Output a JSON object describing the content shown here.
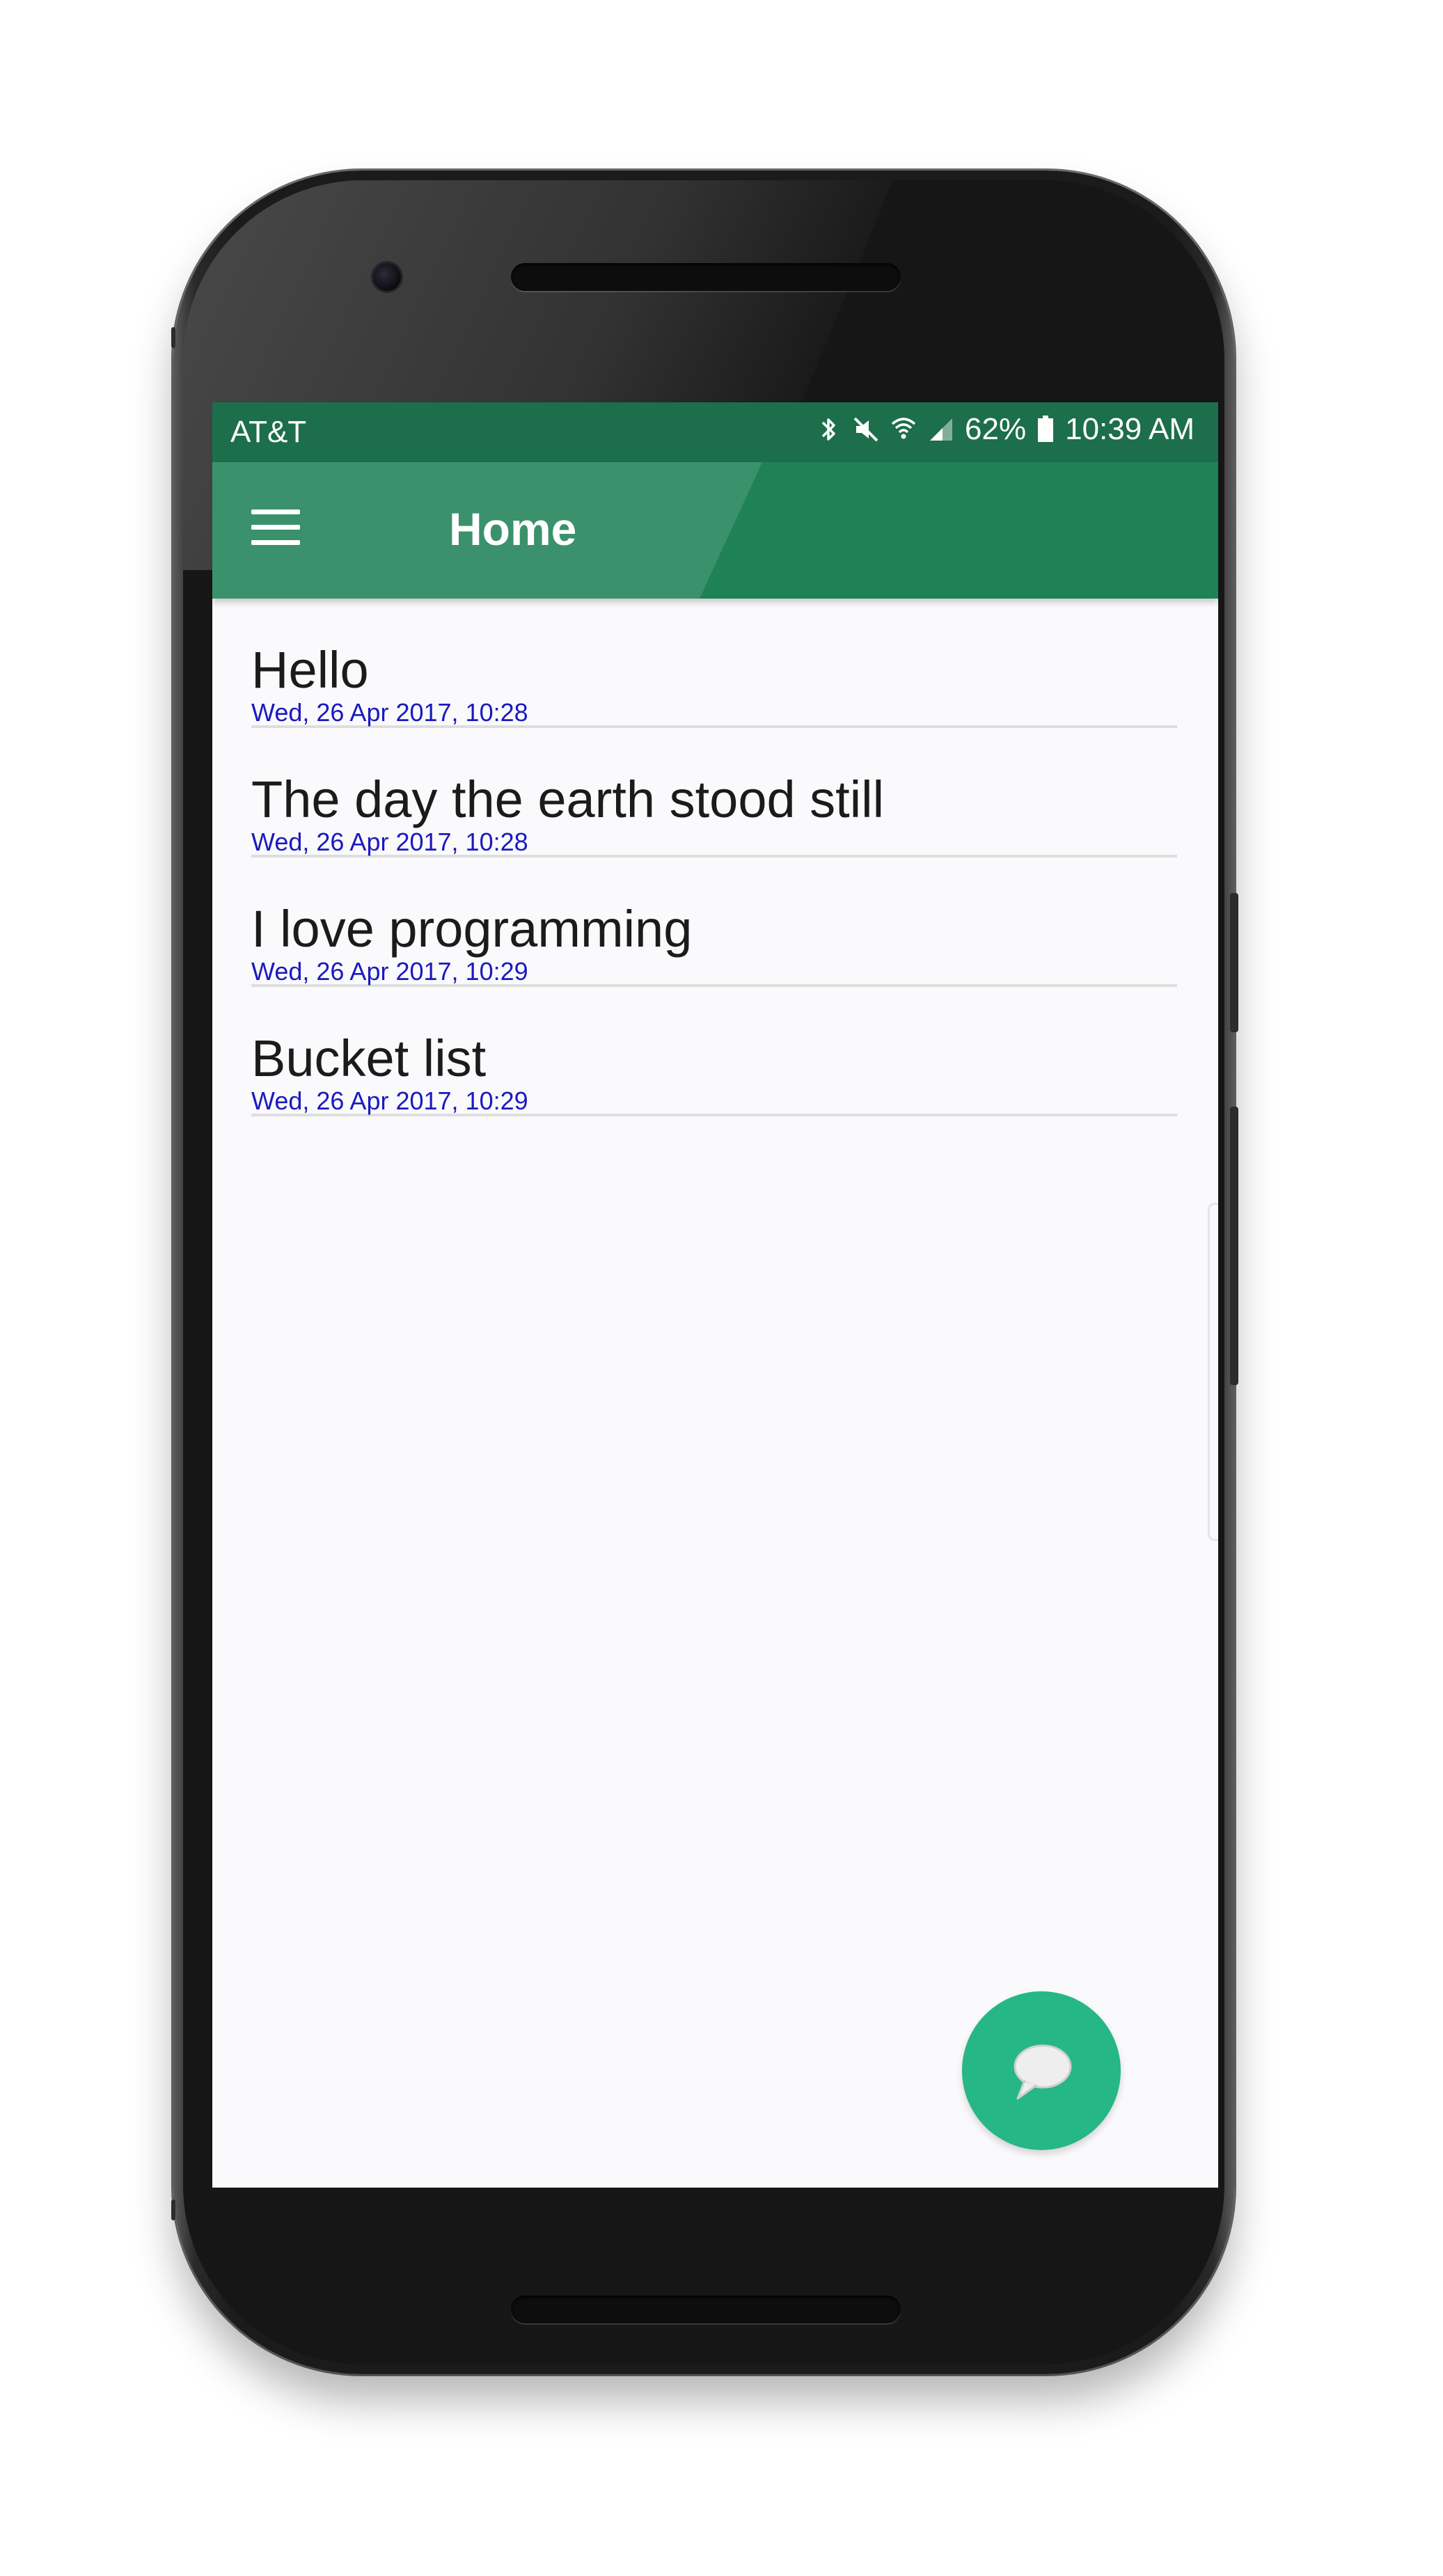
{
  "status_bar": {
    "carrier": "AT&T",
    "battery": "62%",
    "time": "10:39 AM",
    "icons": [
      "bluetooth-icon",
      "mute-icon",
      "wifi-icon",
      "signal-icon",
      "battery-icon"
    ]
  },
  "toolbar": {
    "title": "Home",
    "menu_icon": "hamburger-menu-icon"
  },
  "notes": [
    {
      "title": "Hello",
      "date": "Wed, 26 Apr 2017, 10:28"
    },
    {
      "title": "The day the earth stood still",
      "date": "Wed, 26 Apr 2017, 10:28"
    },
    {
      "title": "I love programming",
      "date": "Wed, 26 Apr 2017, 10:29"
    },
    {
      "title": "Bucket list",
      "date": "Wed, 26 Apr 2017, 10:29"
    }
  ],
  "fab": {
    "icon": "chat-bubble-icon"
  },
  "colors": {
    "status_bar": "#1d6e4b",
    "toolbar": "#1f8257",
    "fab": "#25b785",
    "date_text": "#1a1ac0",
    "background": "#faf9fb"
  }
}
